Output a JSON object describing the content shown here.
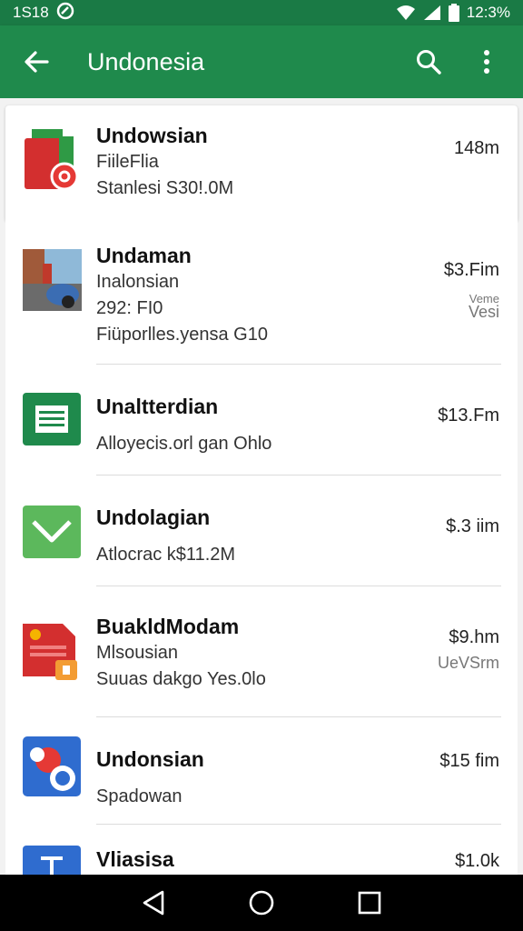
{
  "status_bar": {
    "time": "1S18",
    "clock": "12:3%"
  },
  "app_bar": {
    "title": "Undonesia"
  },
  "items": [
    {
      "name": "Undowsian",
      "lines": [
        "FiileFlia",
        "Stanlesi S30!.0M"
      ],
      "price": "148m",
      "sub": []
    },
    {
      "name": "Undaman",
      "lines": [
        "Inalonsian",
        "292: FI0",
        "Fiüporlles.yensa G10"
      ],
      "price": "$3.Fim",
      "sub": [
        "Veme",
        "Vesi"
      ]
    },
    {
      "name": "Unaltterdian",
      "lines": [
        "Alloyecis.orl gan Ohlo"
      ],
      "price": "$13.Fm",
      "sub": []
    },
    {
      "name": "Undolagian",
      "lines": [
        "Atlocrac k$11.2M"
      ],
      "price": "$.3 iim",
      "sub": []
    },
    {
      "name": "BuakldModam",
      "lines": [
        "Mlsousian",
        "Suuas dakgo Yes.0lo"
      ],
      "price": "$9.hm",
      "sub": [
        "UeVSrm"
      ]
    },
    {
      "name": "Undonsian",
      "lines": [
        "Spadowan"
      ],
      "price": "$15 fim",
      "sub": []
    },
    {
      "name": "Vliasisa",
      "lines": [],
      "price": "$1.0k",
      "sub": []
    }
  ],
  "icons": {
    "back": "arrow-left-icon",
    "search": "search-icon",
    "menu": "more-vert-icon",
    "nav_back": "triangle-back-icon",
    "nav_home": "circle-home-icon",
    "nav_recents": "square-recents-icon"
  },
  "colors": {
    "status_bar": "#1a7a45",
    "app_bar": "#1f8a4c",
    "nav_bar": "#000000"
  }
}
